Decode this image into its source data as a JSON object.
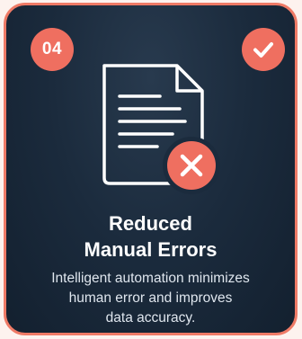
{
  "card": {
    "number": "04",
    "title_lines": [
      "Reduced",
      "Manual Errors"
    ],
    "description_lines": [
      "Intelligent automation minimizes",
      "human error and improves",
      "data accuracy."
    ],
    "icons": {
      "status": "checkmark-icon",
      "illustration": "document-icon",
      "error": "error-x-icon"
    },
    "colors": {
      "accent": "#ef6f60",
      "background": "#1b2b3d",
      "border": "#ef7a66"
    }
  }
}
